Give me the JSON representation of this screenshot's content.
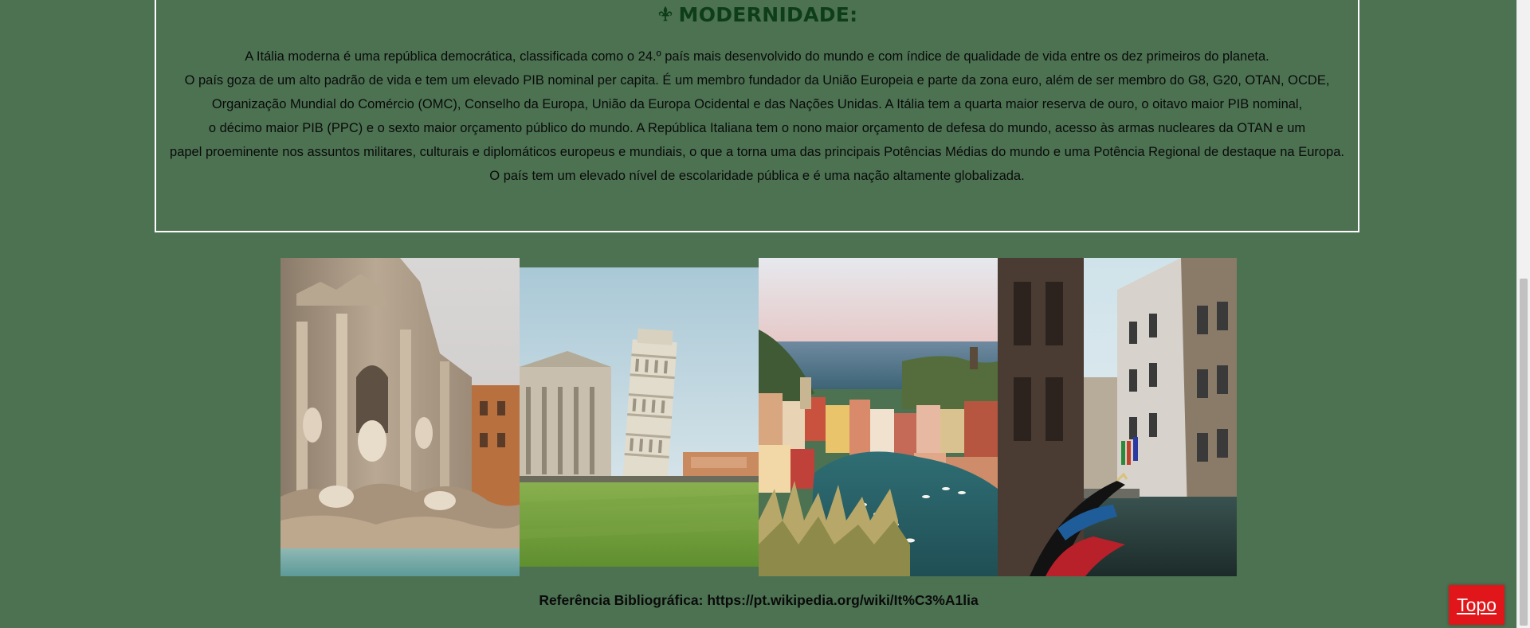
{
  "section": {
    "icon": "fleur-de-lis-icon",
    "title": "MODERNIDADE:",
    "lines": [
      "A Itália moderna é uma república democrática, classificada como o 24.º país mais desenvolvido do mundo e com índice de qualidade de vida entre os dez primeiros do planeta.",
      "O país goza de um alto padrão de vida e tem um elevado PIB nominal per capita. É um membro fundador da União Europeia e parte da zona euro, além de ser membro do G8, G20, OTAN, OCDE,",
      "Organização Mundial do Comércio (OMC), Conselho da Europa, União da Europa Ocidental e das Nações Unidas. A Itália tem a quarta maior reserva de ouro, o oitavo maior PIB nominal,",
      "o décimo maior PIB (PPC) e o sexto maior orçamento público do mundo. A República Italiana tem o nono maior orçamento de defesa do mundo, acesso às armas nucleares da OTAN e um",
      "papel proeminente nos assuntos militares, culturais e diplomáticos europeus e mundiais, o que a torna uma das principais Potências Médias do mundo e uma Potência Regional de destaque na Europa.",
      "O país tem um elevado nível de escolaridade pública e é uma nação altamente globalizada."
    ]
  },
  "gallery": [
    {
      "subject": "trevi-fountain-photo"
    },
    {
      "subject": "leaning-tower-of-pisa-photo"
    },
    {
      "subject": "cinque-terre-vernazza-photo"
    },
    {
      "subject": "venice-canal-gondola-photo"
    }
  ],
  "reference": {
    "text": "Referência Bibliográfica: https://pt.wikipedia.org/wiki/It%C3%A1lia"
  },
  "top_button": {
    "label": "Topo"
  },
  "colors": {
    "background": "#4c7252",
    "title": "#0e3d1a",
    "border": "#ffffff",
    "button": "#e0161a"
  }
}
